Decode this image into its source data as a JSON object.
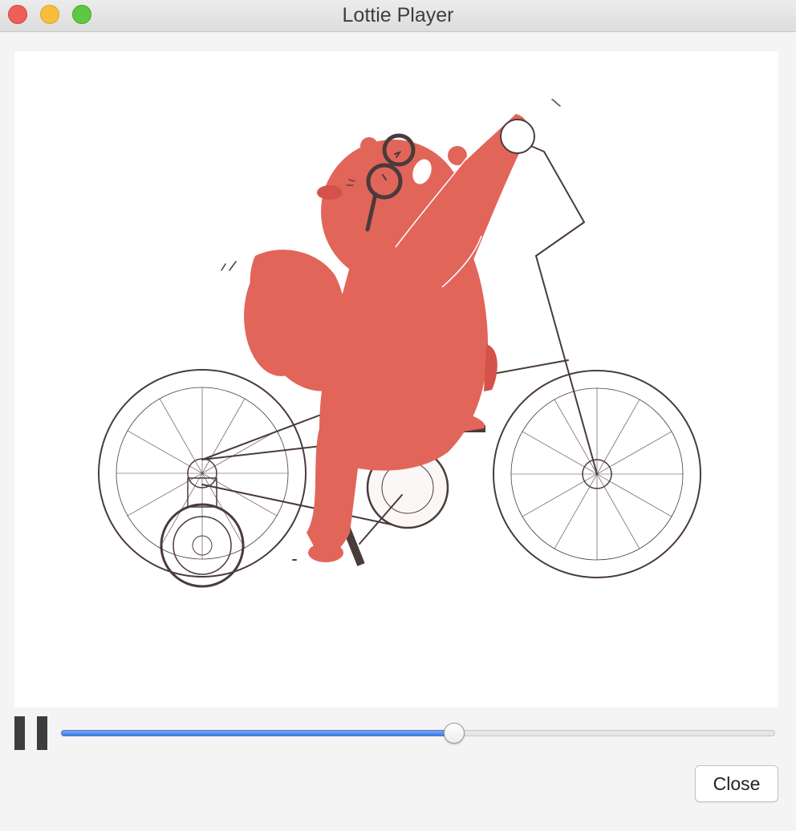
{
  "window": {
    "title": "Lottie Player"
  },
  "player": {
    "animation": "bear-riding-bicycle",
    "playback_state": "playing",
    "progress": 0.55
  },
  "controls": {
    "pause_icon": "pause-icon",
    "close_label": "Close"
  },
  "colors": {
    "bear": "#e2655a",
    "bear_shadow": "#d4524a",
    "outline": "#4a3b3b",
    "slider_fill": "#3c7ae6"
  }
}
